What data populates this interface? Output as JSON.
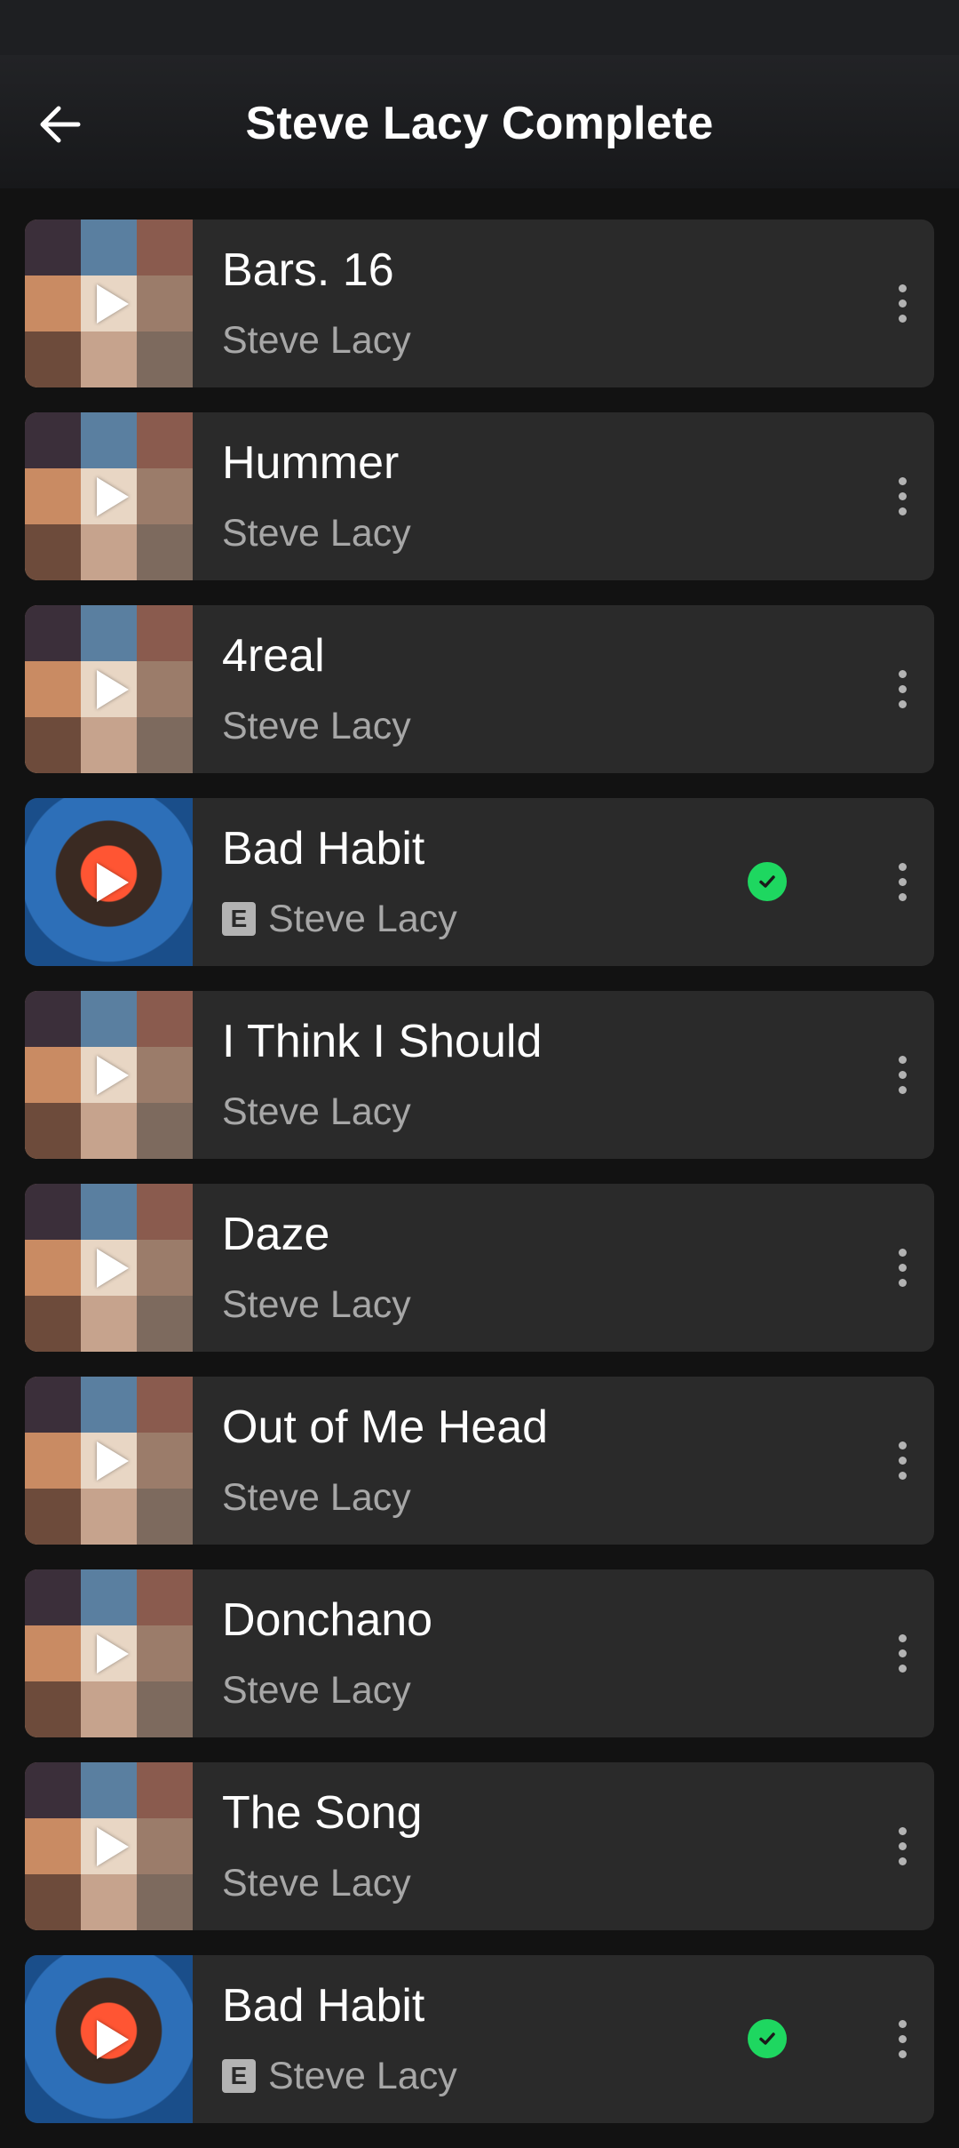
{
  "header": {
    "title": "Steve Lacy Complete"
  },
  "tracks": [
    {
      "title": "Bars. 16",
      "artist": "Steve Lacy",
      "explicit": false,
      "downloaded": false,
      "cover": "collage"
    },
    {
      "title": "Hummer",
      "artist": "Steve Lacy",
      "explicit": false,
      "downloaded": false,
      "cover": "collage"
    },
    {
      "title": "4real",
      "artist": "Steve Lacy",
      "explicit": false,
      "downloaded": false,
      "cover": "collage"
    },
    {
      "title": "Bad Habit",
      "artist": "Steve Lacy",
      "explicit": true,
      "explicit_label": "E",
      "downloaded": true,
      "cover": "portrait"
    },
    {
      "title": "I Think I Should",
      "artist": "Steve Lacy",
      "explicit": false,
      "downloaded": false,
      "cover": "collage"
    },
    {
      "title": "Daze",
      "artist": "Steve Lacy",
      "explicit": false,
      "downloaded": false,
      "cover": "collage"
    },
    {
      "title": "Out of Me Head",
      "artist": "Steve Lacy",
      "explicit": false,
      "downloaded": false,
      "cover": "collage"
    },
    {
      "title": "Donchano",
      "artist": "Steve Lacy",
      "explicit": false,
      "downloaded": false,
      "cover": "collage"
    },
    {
      "title": "The Song",
      "artist": "Steve Lacy",
      "explicit": false,
      "downloaded": false,
      "cover": "collage"
    },
    {
      "title": "Bad Habit",
      "artist": "Steve Lacy",
      "explicit": true,
      "explicit_label": "E",
      "downloaded": true,
      "cover": "portrait"
    }
  ],
  "colors": {
    "background": "#121212",
    "card": "#2a2a2a",
    "accent": "#1ed760",
    "secondary_text": "#a7a7a7"
  },
  "icons": {
    "back": "arrow-left-icon",
    "play": "play-icon",
    "downloaded": "check-circle-icon",
    "more": "more-vertical-icon"
  }
}
